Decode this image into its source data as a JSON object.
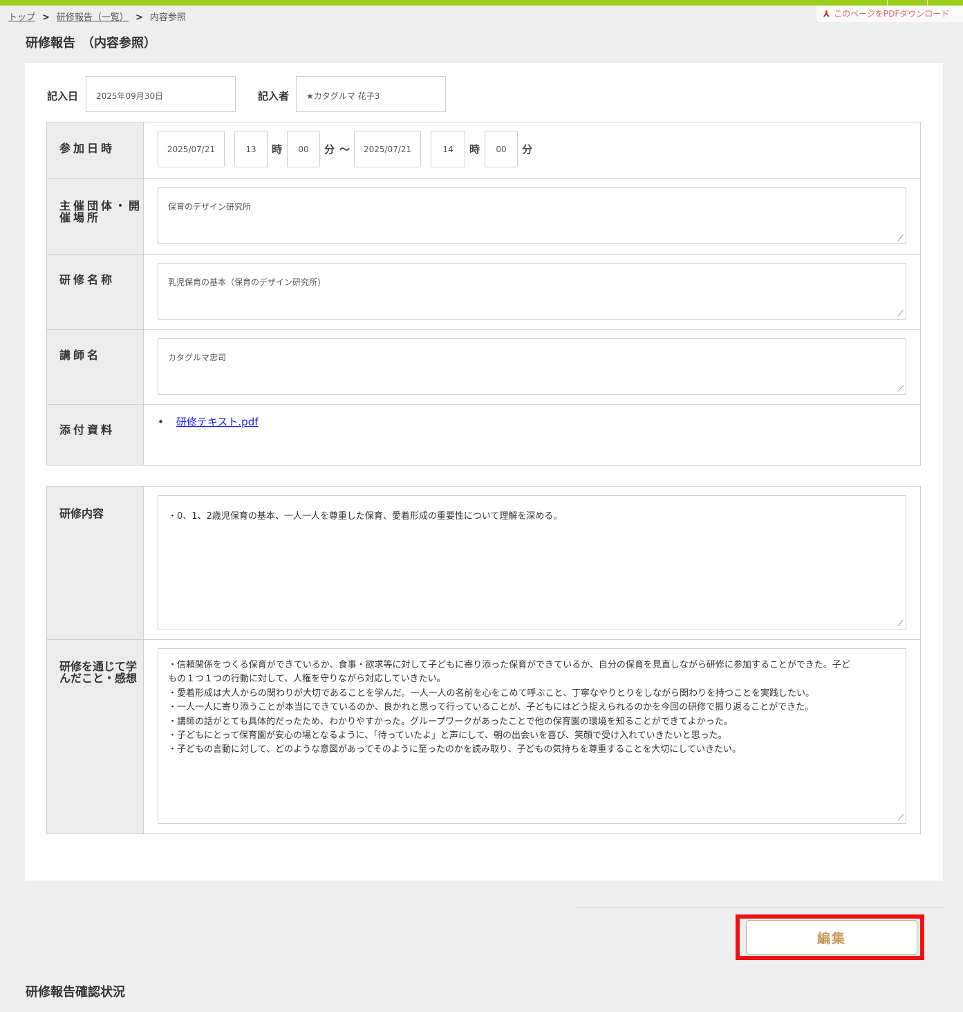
{
  "breadcrumb": {
    "top": "トップ",
    "list": "研修報告（一覧）",
    "current": "内容参照",
    "separator": ">"
  },
  "pdf_download": {
    "label": "このページをPDFダウンロード",
    "icon": "pdf-icon"
  },
  "page_title": "研修報告　（内容参照）",
  "meta": {
    "date_label": "記入日",
    "date_value": "2025年09月30日",
    "author_label": "記入者",
    "author_value": "★カタグルマ 花子3"
  },
  "attendance": {
    "label": "参加日時",
    "start_date": "2025/07/21",
    "start_hour": "13",
    "start_minute": "00",
    "end_date": "2025/07/21",
    "end_hour": "14",
    "end_minute": "00",
    "hour_unit": "時",
    "minute_unit": "分",
    "range_sep": "〜"
  },
  "organizer": {
    "label": "主催団体・開催場所",
    "value": "保育のデザイン研究所"
  },
  "training_name": {
    "label": "研修名称",
    "value": "乳児保育の基本（保育のデザイン研究所)"
  },
  "lecturer": {
    "label": "講師名",
    "value": "カタグルマ忠司"
  },
  "attachments": {
    "label": "添付資料",
    "files": [
      "研修テキスト.pdf"
    ]
  },
  "content": {
    "label": "研修内容",
    "value": "・0、1、2歳児保育の基本、一人一人を尊重した保育、愛着形成の重要性について理解を深める。"
  },
  "learnings": {
    "label": "研修を通じて学んだこと・感想",
    "lines": [
      "・信頼関係をつくる保育ができているか、食事・欲求等に対して子どもに寄り添った保育ができているか、自分の保育を見直しながら研修に参加することができた。子ど",
      "もの１つ１つの行動に対して、人権を守りながら対応していきたい。",
      "",
      "・愛着形成は大人からの関わりが大切であることを学んだ。一人一人の名前を心をこめて呼ぶこと、丁寧なやりとりをしながら関わりを持つことを実践したい。",
      "",
      "・一人一人に寄り添うことが本当にできているのか、良かれと思って行っていることが、子どもにはどう捉えられるのかを今回の研修で振り返ることができた。",
      "",
      "・講師の話がとても具体的だったため、わかりやすかった。グループワークがあったことで他の保育園の環境を知ることができてよかった。",
      "・子どもにとって保育園が安心の場となるように、「待っていたよ」と声にして、朝の出会いを喜び、笑顔で受け入れていきたいと思った。",
      "",
      "・子どもの言動に対して、どのような意図があってそのように至ったのかを読み取り、子どもの気持ちを尊重することを大切にしていきたい。"
    ]
  },
  "edit_button": "編集",
  "confirmation_section_title": "研修報告確認状況"
}
